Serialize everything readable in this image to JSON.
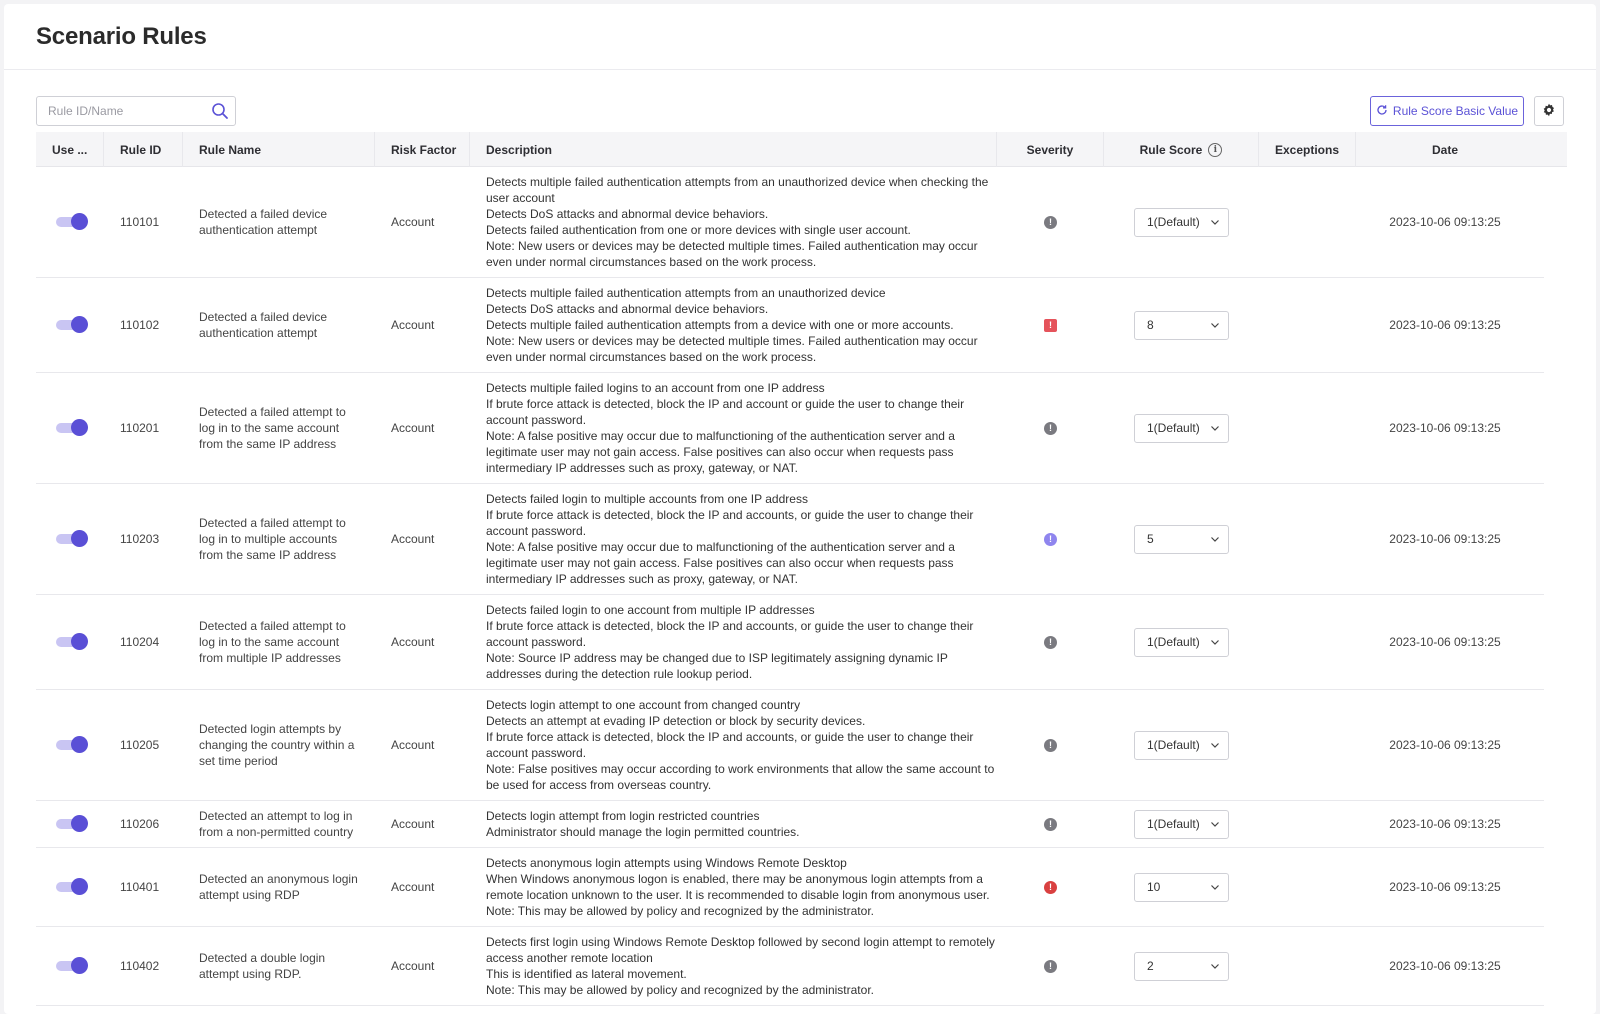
{
  "page": {
    "title": "Scenario Rules"
  },
  "search": {
    "placeholder": "Rule ID/Name"
  },
  "toolbar": {
    "reset_label": "Rule Score Basic Value"
  },
  "table": {
    "headers": {
      "use": "Use ...",
      "rule_id": "Rule ID",
      "rule_name": "Rule Name",
      "risk_factor": "Risk Factor",
      "description": "Description",
      "severity": "Severity",
      "rule_score": "Rule Score",
      "exceptions": "Exceptions",
      "date": "Date"
    },
    "rows": [
      {
        "enabled": true,
        "id": "110101",
        "name": "Detected a failed device authentication attempt",
        "risk": "Account",
        "description": [
          "Detects multiple failed authentication attempts from an unauthorized device when checking the user account",
          "Detects DoS attacks and abnormal device behaviors.",
          "Detects failed authentication from one or more devices with single user account.",
          "Note: New users or devices may be detected multiple times. Failed authentication may occur even under normal circumstances based on the work process."
        ],
        "severity": "low",
        "score": "1(Default)",
        "exceptions": "",
        "date": "2023-10-06 09:13:25"
      },
      {
        "enabled": true,
        "id": "110102",
        "name": "Detected a failed device authentication attempt",
        "risk": "Account",
        "description": [
          "Detects multiple failed authentication attempts from an unauthorized device",
          "Detects DoS attacks and abnormal device behaviors.",
          "Detects multiple failed authentication attempts from a device with one or more accounts.",
          "Note: New users or devices may be detected multiple times. Failed authentication may occur even under normal circumstances based on the work process."
        ],
        "severity": "high",
        "score": "8",
        "exceptions": "",
        "date": "2023-10-06 09:13:25"
      },
      {
        "enabled": true,
        "id": "110201",
        "name": "Detected a failed attempt to log in to the same account from the same IP address",
        "risk": "Account",
        "description": [
          "Detects multiple failed logins to an account from one IP address",
          "If brute force attack is detected, block the IP and account or guide the user to change their account password.",
          "Note: A false positive may occur due to malfunctioning of the authentication server and a legitimate user may not gain access. False positives can also occur when requests pass intermediary IP addresses such as proxy, gateway, or NAT."
        ],
        "severity": "low",
        "score": "1(Default)",
        "exceptions": "",
        "date": "2023-10-06 09:13:25"
      },
      {
        "enabled": true,
        "id": "110203",
        "name": "Detected a failed attempt to log in to multiple accounts from the same IP address",
        "risk": "Account",
        "description": [
          "Detects failed login to multiple accounts from one IP address",
          "If brute force attack is detected, block the IP and accounts, or guide the user to change their account password.",
          "Note: A false positive may occur due to malfunctioning of the authentication server and a legitimate user may not gain access. False positives can also occur when requests pass intermediary IP addresses such as proxy, gateway, or NAT."
        ],
        "severity": "medium",
        "score": "5",
        "exceptions": "",
        "date": "2023-10-06 09:13:25"
      },
      {
        "enabled": true,
        "id": "110204",
        "name": "Detected a failed attempt to log in to the same account from multiple IP addresses",
        "risk": "Account",
        "description": [
          "Detects failed login to one account from multiple IP addresses",
          "If brute force attack is detected, block the IP and accounts, or guide the user to change their account password.",
          "Note: Source IP address may be changed due to ISP legitimately assigning dynamic IP addresses during the detection rule lookup period."
        ],
        "severity": "low",
        "score": "1(Default)",
        "exceptions": "",
        "date": "2023-10-06 09:13:25"
      },
      {
        "enabled": true,
        "id": "110205",
        "name": "Detected login attempts by changing the country within a set time period",
        "risk": "Account",
        "description": [
          "Detects login attempt to one account from changed country",
          "Detects an attempt at evading IP detection or block by security devices.",
          "If brute force attack is detected, block the IP and accounts, or guide the user to change their account password.",
          "Note: False positives may occur according to work environments that allow the same account to be used for access from overseas country."
        ],
        "severity": "low",
        "score": "1(Default)",
        "exceptions": "",
        "date": "2023-10-06 09:13:25"
      },
      {
        "enabled": true,
        "id": "110206",
        "name": "Detected an attempt to log in from a non-permitted country",
        "risk": "Account",
        "description": [
          "Detects login attempt from login restricted countries",
          "Administrator should manage the login permitted countries."
        ],
        "severity": "low",
        "score": "1(Default)",
        "exceptions": "",
        "date": "2023-10-06 09:13:25"
      },
      {
        "enabled": true,
        "id": "110401",
        "name": "Detected an anonymous login attempt using RDP",
        "risk": "Account",
        "description": [
          "Detects anonymous login attempts using Windows Remote Desktop",
          "When Windows anonymous logon is enabled, there may be anonymous login attempts from a remote location unknown to the user. It is recommended to disable login from anonymous user.",
          "Note: This may be allowed by policy and recognized by the administrator."
        ],
        "severity": "critical",
        "score": "10",
        "exceptions": "",
        "date": "2023-10-06 09:13:25"
      },
      {
        "enabled": true,
        "id": "110402",
        "name": "Detected a double login attempt using RDP.",
        "risk": "Account",
        "description": [
          "Detects first login using Windows Remote Desktop followed by second login attempt to remotely access another remote location",
          "This is identified as lateral movement.",
          "Note: This may be allowed by policy and recognized by the administrator."
        ],
        "severity": "low",
        "score": "2",
        "exceptions": "",
        "date": "2023-10-06 09:13:25"
      }
    ]
  },
  "colors": {
    "accent": "#5a4fd6",
    "toggle_track": "#c9c5f3",
    "severity_low": "#7a7a80",
    "severity_medium": "#8f85ee",
    "severity_high": "#e5535b",
    "severity_critical": "#d94040"
  },
  "icons": {
    "search": "search-icon",
    "reset": "refresh-icon",
    "settings": "gear-icon",
    "info": "info-icon",
    "dropdown": "chevron-down-icon"
  }
}
